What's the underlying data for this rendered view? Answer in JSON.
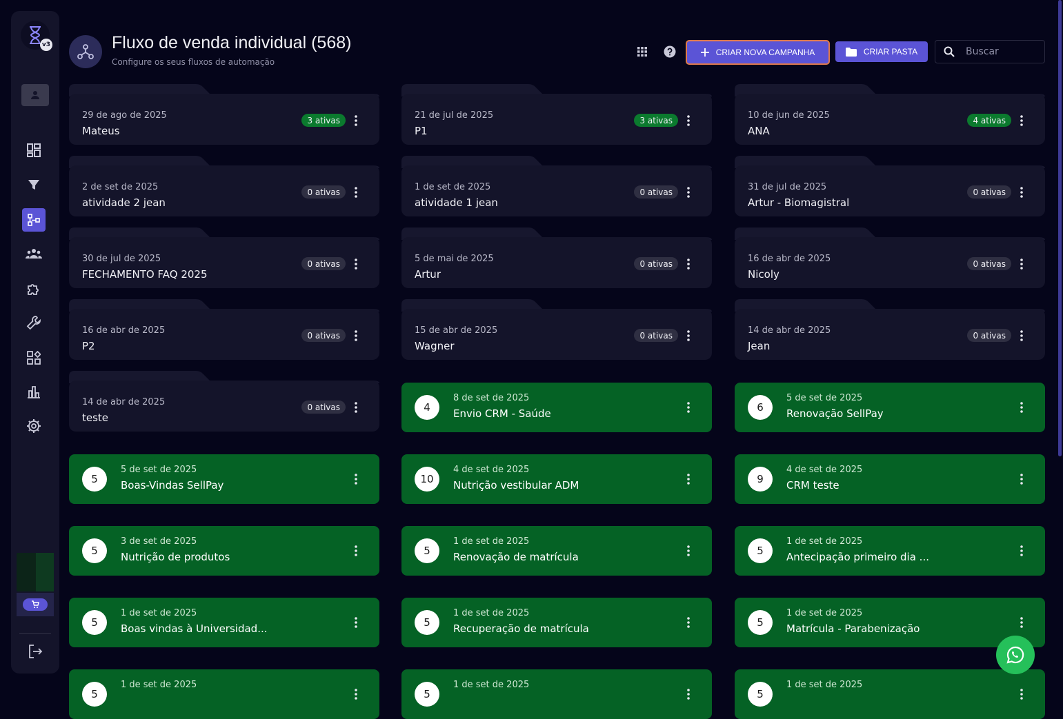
{
  "header": {
    "title": "Fluxo de venda individual",
    "count": "(568)",
    "subtitle": "Configure os seus fluxos de automação",
    "create_button": "CRIAR NOVA CAMPANHA",
    "folder_button": "CRIAR PASTA",
    "search_placeholder": "Buscar"
  },
  "sidebar": {
    "version_badge": "v3",
    "items": [
      {
        "icon": "dashboard-icon"
      },
      {
        "icon": "filter-icon"
      },
      {
        "icon": "flow-icon",
        "active": true
      },
      {
        "icon": "team-icon"
      },
      {
        "icon": "puzzle-icon"
      },
      {
        "icon": "wrench-icon"
      },
      {
        "icon": "widgets-icon"
      },
      {
        "icon": "chart-icon"
      },
      {
        "icon": "settings-icon"
      }
    ]
  },
  "folders": [
    {
      "date": "29 de ago de 2025",
      "name": "Mateus",
      "badge": "3 ativas",
      "status": "green"
    },
    {
      "date": "21 de jul de 2025",
      "name": "P1",
      "badge": "3 ativas",
      "status": "green"
    },
    {
      "date": "10 de jun de 2025",
      "name": "ANA",
      "badge": "4 ativas",
      "status": "green"
    },
    {
      "date": "2 de set de 2025",
      "name": "atividade 2 jean",
      "badge": "0 ativas",
      "status": "gray"
    },
    {
      "date": "1 de set de 2025",
      "name": "atividade 1 jean",
      "badge": "0 ativas",
      "status": "gray"
    },
    {
      "date": "31 de jul de 2025",
      "name": "Artur - Biomagistral",
      "badge": "0 ativas",
      "status": "gray"
    },
    {
      "date": "30 de jul de 2025",
      "name": "FECHAMENTO FAQ 2025",
      "badge": "0 ativas",
      "status": "gray"
    },
    {
      "date": "5 de mai de 2025",
      "name": "Artur",
      "badge": "0 ativas",
      "status": "gray"
    },
    {
      "date": "16 de abr de 2025",
      "name": "Nicoly",
      "badge": "0 ativas",
      "status": "gray"
    },
    {
      "date": "16 de abr de 2025",
      "name": "P2",
      "badge": "0 ativas",
      "status": "gray"
    },
    {
      "date": "15 de abr de 2025",
      "name": "Wagner",
      "badge": "0 ativas",
      "status": "gray"
    },
    {
      "date": "14 de abr de 2025",
      "name": "Jean",
      "badge": "0 ativas",
      "status": "gray"
    },
    {
      "date": "14 de abr de 2025",
      "name": "teste",
      "badge": "0 ativas",
      "status": "gray"
    }
  ],
  "campaigns": [
    {
      "count": "4",
      "date": "8 de set de 2025",
      "name": "Envio CRM - Saúde"
    },
    {
      "count": "6",
      "date": "5 de set de 2025",
      "name": "Renovação SellPay"
    },
    {
      "count": "5",
      "date": "5 de set de 2025",
      "name": "Boas-Vindas SellPay"
    },
    {
      "count": "10",
      "date": "4 de set de 2025",
      "name": "Nutrição vestibular ADM"
    },
    {
      "count": "9",
      "date": "4 de set de 2025",
      "name": "CRM teste"
    },
    {
      "count": "5",
      "date": "3 de set de 2025",
      "name": "Nutrição de produtos"
    },
    {
      "count": "5",
      "date": "1 de set de 2025",
      "name": "Renovação de matrícula"
    },
    {
      "count": "5",
      "date": "1 de set de 2025",
      "name": "Antecipação primeiro dia ..."
    },
    {
      "count": "5",
      "date": "1 de set de 2025",
      "name": "Boas vindas à Universidad..."
    },
    {
      "count": "5",
      "date": "1 de set de 2025",
      "name": "Recuperação de matrícula"
    },
    {
      "count": "5",
      "date": "1 de set de 2025",
      "name": "Matrícula - Parabenização"
    },
    {
      "count": "5",
      "date": "1 de set de 2025",
      "name": ""
    },
    {
      "count": "5",
      "date": "1 de set de 2025",
      "name": ""
    },
    {
      "count": "5",
      "date": "1 de set de 2025",
      "name": ""
    }
  ],
  "colors": {
    "background": "#05051a",
    "card": "#14142a",
    "accent": "#5b54d6",
    "campaign_green": "#056225",
    "badge_green": "#0b7a2e"
  }
}
